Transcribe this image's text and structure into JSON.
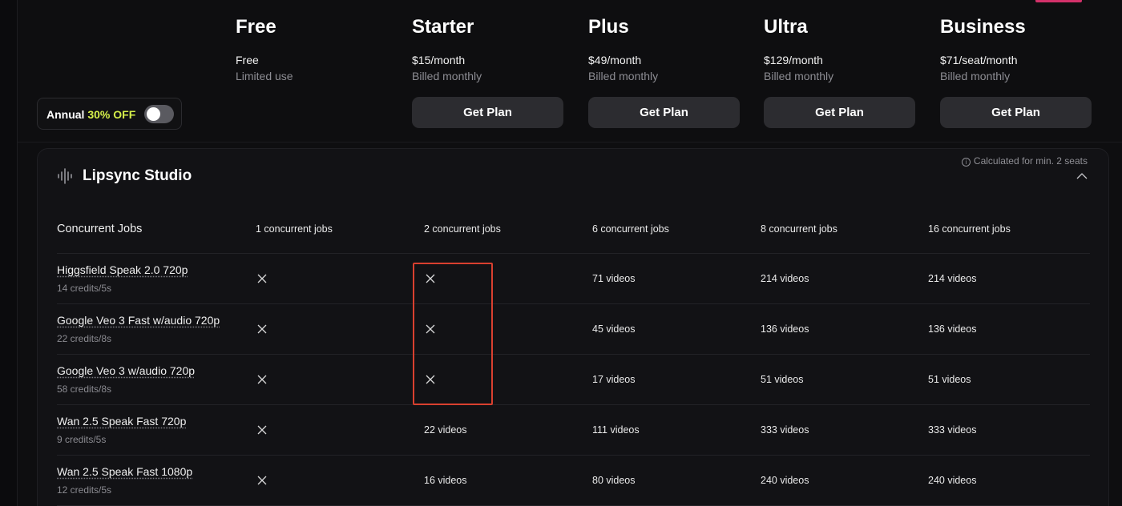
{
  "plans": [
    {
      "name": "Free",
      "price": "Free",
      "billing": "Limited use",
      "button": null
    },
    {
      "name": "Starter",
      "price": "$15/month",
      "billing": "Billed monthly",
      "button": "Get Plan"
    },
    {
      "name": "Plus",
      "price": "$49/month",
      "billing": "Billed monthly",
      "button": "Get Plan"
    },
    {
      "name": "Ultra",
      "price": "$129/month",
      "billing": "Billed monthly",
      "button": "Get Plan"
    },
    {
      "name": "Business",
      "price": "$71/seat/month",
      "billing": "Billed monthly",
      "button": "Get Plan"
    }
  ],
  "annual_toggle": {
    "label": "Annual",
    "discount": "30% OFF",
    "enabled": false
  },
  "section": {
    "title": "Lipsync Studio",
    "icon": "audio-waveform-icon",
    "note": "Calculated for min. 2 seats",
    "collapse_icon": "chevron-up-icon"
  },
  "table": {
    "header": {
      "label": "Concurrent Jobs",
      "values": [
        "1 concurrent jobs",
        "2 concurrent jobs",
        "6 concurrent jobs",
        "8 concurrent jobs",
        "16 concurrent jobs"
      ]
    },
    "rows": [
      {
        "name": "Higgsfield Speak 2.0 720p",
        "credits": "14 credits/5s",
        "values": [
          null,
          null,
          "71 videos",
          "214 videos",
          "214 videos"
        ]
      },
      {
        "name": "Google Veo 3 Fast w/audio 720p",
        "credits": "22 credits/8s",
        "values": [
          null,
          null,
          "45 videos",
          "136 videos",
          "136 videos"
        ]
      },
      {
        "name": "Google Veo 3 w/audio 720p",
        "credits": "58 credits/8s",
        "values": [
          null,
          null,
          "17 videos",
          "51 videos",
          "51 videos"
        ]
      },
      {
        "name": "Wan 2.5 Speak Fast 720p",
        "credits": "9 credits/5s",
        "values": [
          null,
          "22 videos",
          "111 videos",
          "333 videos",
          "333 videos"
        ]
      },
      {
        "name": "Wan 2.5 Speak Fast 1080p",
        "credits": "12 credits/5s",
        "values": [
          null,
          "16 videos",
          "80 videos",
          "240 videos",
          "240 videos"
        ]
      }
    ],
    "unavailable_icon": "x-icon"
  },
  "colors": {
    "background": "#0e0e10",
    "accent": "#d6f04a",
    "highlight": "#d9402f",
    "button": "#2c2c30"
  }
}
